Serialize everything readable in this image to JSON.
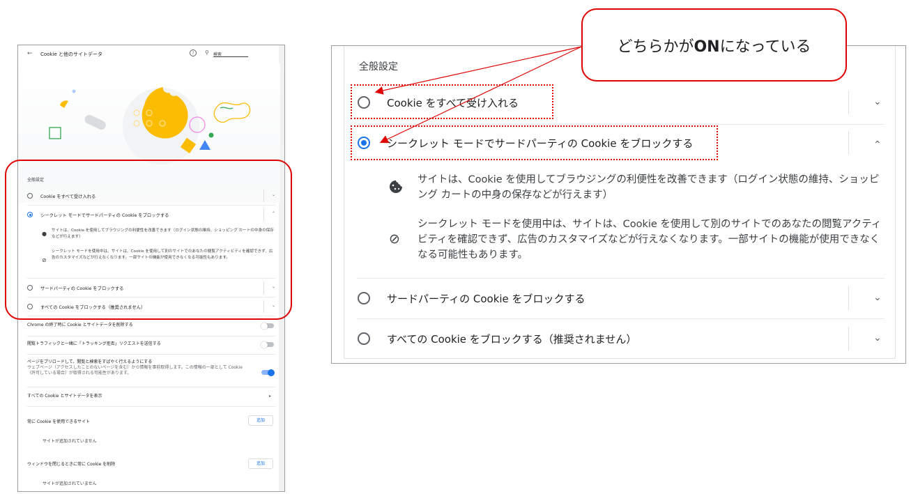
{
  "left_page": {
    "back_label": "←",
    "title": "Cookie と他のサイトデータ",
    "help_icon": "?",
    "search_icon": "⚲",
    "search_placeholder": "検索",
    "section_title": "全般設定",
    "options": [
      {
        "label": "Cookie をすべて受け入れる",
        "selected": false
      },
      {
        "label": "シークレット モードでサードパーティの Cookie をブロックする",
        "selected": true
      },
      {
        "label": "サードパーティの Cookie をブロックする",
        "selected": false
      },
      {
        "label": "すべての Cookie をブロックする（推奨されません）",
        "selected": false
      }
    ],
    "desc_1": "サイトは、Cookie を使用してブラウジングの利便性を改善できます（ログイン状態の維持、ショッピング カートの中身の保存などが行えます）",
    "desc_2": "シークレット モードを使用中は、サイトは、Cookie を使用して別のサイトでのあなたの閲覧アクティビティを確認できず、広告のカスタマイズなどが行えなくなります。一部サイトの機能が使用できなくなる可能性もあります。",
    "toggles": [
      {
        "label": "Chrome の終了時に Cookie とサイトデータを削除する",
        "on": false
      },
      {
        "label": "閲覧トラフィックと一緒に「トラッキング拒否」リクエストを送信する",
        "on": false
      },
      {
        "label": "ページをプリロードして、閲覧と検索をすばやく行えるようにする",
        "sub": "ウェブページ（アクセスしたことのないページを含む）から情報を事前取得します。この情報の一部として Cookie（許可している場合）が取得される可能性があります。",
        "on": true
      }
    ],
    "see_all_label": "すべての Cookie とサイトデータを表示",
    "allow_sites_label": "常に Cookie を使用できるサイト",
    "clear_on_exit_label": "ウィンドウを閉じるときに常に Cookie を削除",
    "add_button_label": "追加",
    "no_sites_label": "サイトが追加されていません"
  },
  "right_panel": {
    "section_title": "全般設定",
    "options": [
      {
        "label": "Cookie をすべて受け入れる",
        "selected": false
      },
      {
        "label": "シークレット モードでサードパーティの Cookie をブロックする",
        "selected": true
      },
      {
        "label": "サードパーティの Cookie をブロックする",
        "selected": false
      },
      {
        "label": "すべての Cookie をブロックする（推奨されません）",
        "selected": false
      }
    ],
    "desc_1": "サイトは、Cookie を使用してブラウジングの利便性を改善できます（ログイン状態の維持、ショッピング カートの中身の保存などが行えます）",
    "desc_2": "シークレット モードを使用中は、サイトは、Cookie を使用して別のサイトでのあなたの閲覧アクティビティを確認できず、広告のカスタマイズなどが行えなくなります。一部サイトの機能が使用できなくなる可能性もあります。",
    "chevron_down": "⌄",
    "chevron_up": "⌃",
    "cookie_icon": "🍪",
    "block_icon": "⊘"
  },
  "callout": {
    "text_before": "どちらかが",
    "text_bold": "ON",
    "text_after": "になっている"
  },
  "colors": {
    "accent": "#1a73e8",
    "annotation_red": "#e00000"
  }
}
